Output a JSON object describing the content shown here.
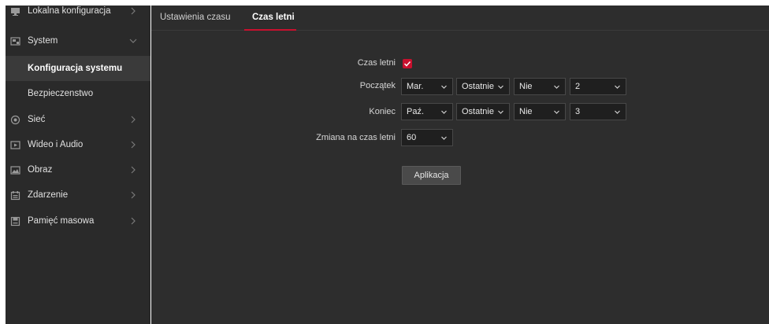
{
  "sidebar": {
    "items": [
      {
        "label": "Lokalna konfiguracja",
        "icon": "monitor-icon"
      },
      {
        "label": "System",
        "icon": "system-icon"
      },
      {
        "label": "Konfiguracja systemu"
      },
      {
        "label": "Bezpieczenstwo"
      },
      {
        "label": "Sieć",
        "icon": "network-icon"
      },
      {
        "label": "Wideo i Audio",
        "icon": "video-icon"
      },
      {
        "label": "Obraz",
        "icon": "image-icon"
      },
      {
        "label": "Zdarzenie",
        "icon": "event-icon"
      },
      {
        "label": "Pamięć masowa",
        "icon": "storage-icon"
      }
    ]
  },
  "tabs": [
    {
      "label": "Ustawienia czasu"
    },
    {
      "label": "Czas letni"
    }
  ],
  "form": {
    "dst_label": "Czas letni",
    "dst_enabled": true,
    "start_label": "Początek",
    "start": {
      "month": "Mar.",
      "week": "Ostatnie",
      "day": "Nie",
      "hour": "2"
    },
    "end_label": "Koniec",
    "end": {
      "month": "Paź.",
      "week": "Ostatnie",
      "day": "Nie",
      "hour": "3"
    },
    "shift_label": "Zmiana na czas letni",
    "shift_value": "60",
    "apply_label": "Aplikacja"
  },
  "colors": {
    "accent": "#c8102e",
    "sidebar_bg": "#2a2a2a",
    "main_bg": "#2d2d2d",
    "active_item_bg": "#3a3a3a"
  }
}
